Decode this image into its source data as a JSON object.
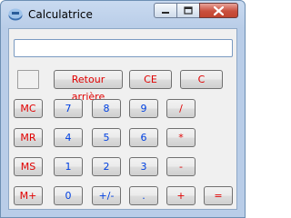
{
  "window": {
    "title": "Calculatrice",
    "icon": "calculator-app-icon",
    "controls": [
      "minimize-icon",
      "maximize-icon",
      "close-icon"
    ]
  },
  "display": {
    "value": ""
  },
  "buttons": {
    "backspace": "Retour arrière",
    "ce": "CE",
    "c": "C",
    "mc": "MC",
    "mr": "MR",
    "ms": "MS",
    "mplus": "M+",
    "d7": "7",
    "d8": "8",
    "d9": "9",
    "d4": "4",
    "d5": "5",
    "d6": "6",
    "d1": "1",
    "d2": "2",
    "d3": "3",
    "d0": "0",
    "sign": "+/-",
    "dot": ".",
    "divide": "/",
    "multiply": "*",
    "minus": "-",
    "plus": "+",
    "equals": "="
  },
  "colors": {
    "operator_text": "#e00000",
    "digit_text": "#0040e0",
    "title_bar": "#b9cde8"
  }
}
